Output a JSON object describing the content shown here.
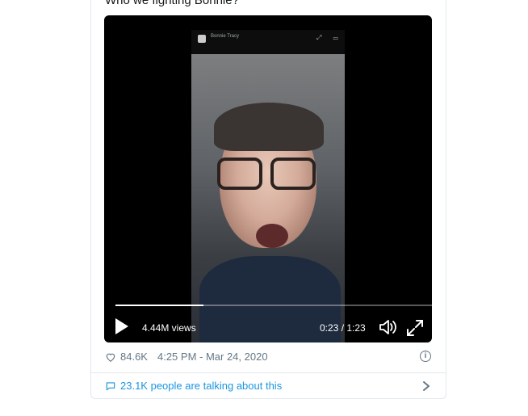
{
  "tweet": {
    "text": "Who we fighting Bonnie?"
  },
  "video": {
    "inner_name": "Bonnie Tracy",
    "views": "4.44M views",
    "time": "0:23 / 1:23",
    "progress": 0.277
  },
  "meta": {
    "likes": "84.6K",
    "timestamp": "4:25 PM - Mar 24, 2020"
  },
  "footer": {
    "talking": "23.1K people are talking about this"
  },
  "icons": {
    "play": "play-icon",
    "volume": "volume-icon",
    "fullscreen": "fullscreen-icon",
    "heart": "heart-icon",
    "info": "info-icon",
    "bubble": "chat-bubble-icon",
    "chevron": "chevron-right-icon"
  },
  "colors": {
    "link": "#1b95e0",
    "muted": "#657786",
    "border": "#e1e8ed"
  }
}
